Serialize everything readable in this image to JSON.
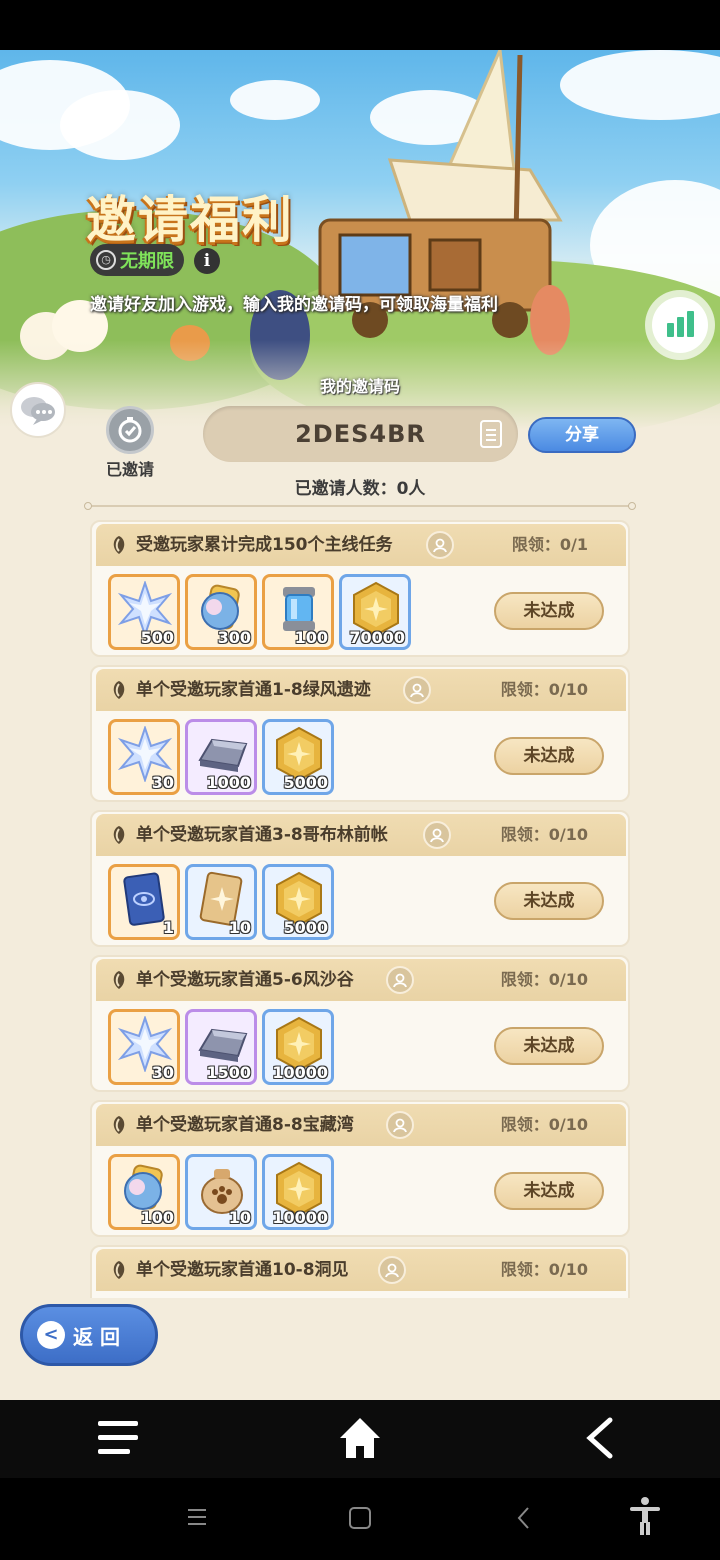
{
  "banner": {
    "title": "邀请福利",
    "time_label": "无期限",
    "subtitle": "邀请好友加入游戏，输入我的邀请码，可领取海量福利"
  },
  "invite": {
    "caption": "我的邀请码",
    "invited_label": "已邀请",
    "code": "2DES4BR",
    "share_label": "分享",
    "count_line": "已邀请人数：0人"
  },
  "tasks": [
    {
      "name": "受邀玩家累计完成150个主线任务",
      "limit": "限领：0/1",
      "status": "未达成",
      "rewards": [
        {
          "icon": "crystal-star-icon",
          "qty": "500"
        },
        {
          "icon": "crystal-orb-icon",
          "qty": "300"
        },
        {
          "icon": "capsule-icon",
          "qty": "100"
        },
        {
          "icon": "gold-coin-icon",
          "qty": "70000"
        }
      ]
    },
    {
      "name": "单个受邀玩家首通1-8绿风遗迹",
      "limit": "限领：0/10",
      "status": "未达成",
      "rewards": [
        {
          "icon": "crystal-star-icon",
          "qty": "30"
        },
        {
          "icon": "iron-ingot-icon",
          "qty": "1000"
        },
        {
          "icon": "gold-coin-icon",
          "qty": "5000"
        }
      ]
    },
    {
      "name": "单个受邀玩家首通3-8哥布林前帐",
      "limit": "限领：0/10",
      "status": "未达成",
      "rewards": [
        {
          "icon": "blue-card-icon",
          "qty": "1"
        },
        {
          "icon": "gold-card-icon",
          "qty": "10"
        },
        {
          "icon": "gold-coin-icon",
          "qty": "5000"
        }
      ]
    },
    {
      "name": "单个受邀玩家首通5-6风沙谷",
      "limit": "限领：0/10",
      "status": "未达成",
      "rewards": [
        {
          "icon": "crystal-star-icon",
          "qty": "30"
        },
        {
          "icon": "iron-ingot-icon",
          "qty": "1500"
        },
        {
          "icon": "gold-coin-icon",
          "qty": "10000"
        }
      ]
    },
    {
      "name": "单个受邀玩家首通8-8宝藏湾",
      "limit": "限领：0/10",
      "status": "未达成",
      "rewards": [
        {
          "icon": "crystal-orb-icon",
          "qty": "100"
        },
        {
          "icon": "paw-bag-icon",
          "qty": "10"
        },
        {
          "icon": "gold-coin-icon",
          "qty": "10000"
        }
      ]
    },
    {
      "name": "单个受邀玩家首通10-8洞见",
      "limit": "限领：0/10",
      "status": "",
      "rewards": []
    }
  ],
  "back_button": {
    "label": "返 回"
  },
  "colors": {
    "accent_blue": "#4b8ae2",
    "panel_bg": "#f3ecdc",
    "header_tan": "#e9d3a5",
    "stats_green": "#3fbf8b"
  }
}
